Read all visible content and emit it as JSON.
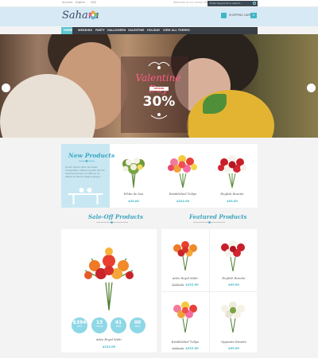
{
  "topbar": {
    "links": [
      "Account",
      "English",
      "USD"
    ],
    "welcome": "Welcome to our online store",
    "search_placeholder": "Enter keywords to search..."
  },
  "header": {
    "logo": "Sahara",
    "cart_label": "SHOPPING CART",
    "cart_count": "0"
  },
  "nav": {
    "items": [
      "HOME",
      "WEDDING",
      "PARTY",
      "HALLOWEEN",
      "VALENTINE",
      "HOLIDAY",
      "VIEW ALL THEMES"
    ]
  },
  "hero": {
    "title": "Valentine Day",
    "subtitle": "SEASON",
    "discount": "30%"
  },
  "new_products": {
    "title": "New Products",
    "description": "Lorem ipsum dolor sit amet, consectetur adipiscing elit, sed do eiusmod tempor incididunt ut labore et dolore magna aliqua.",
    "items": [
      {
        "name": "White de bou",
        "price": "$33.00"
      },
      {
        "name": "Established Tulips",
        "price": "$322.00"
      },
      {
        "name": "English Roseite",
        "price": "$93.00"
      }
    ]
  },
  "sale_off": {
    "title": "Sale-Off Products",
    "product_name": "Adeo Royal Mahr",
    "price": "$222.00",
    "countdown": [
      {
        "value": "$394",
        "unit": "DAYS"
      },
      {
        "value": "13",
        "unit": "HOURS"
      },
      {
        "value": "41",
        "unit": "MINS"
      },
      {
        "value": "00",
        "unit": "SECS"
      }
    ]
  },
  "featured": {
    "title": "Featured Products",
    "items": [
      {
        "name": "Adeo Royal Mahr",
        "old_price": "$230.00",
        "price": "$222.00"
      },
      {
        "name": "English Roseite",
        "old_price": "",
        "price": "$93.00"
      },
      {
        "name": "Established Tulips",
        "old_price": "$330.00",
        "price": "$322.00"
      },
      {
        "name": "Opposite Roseite",
        "old_price": "",
        "price": "$93.00"
      }
    ]
  },
  "colors": {
    "accent": "#3fb6c6",
    "nav_bg": "#3a3f46",
    "header_bg": "#d6e9f5",
    "title_teal": "#3fa5c0",
    "hero_pink": "#ff5f8a"
  }
}
